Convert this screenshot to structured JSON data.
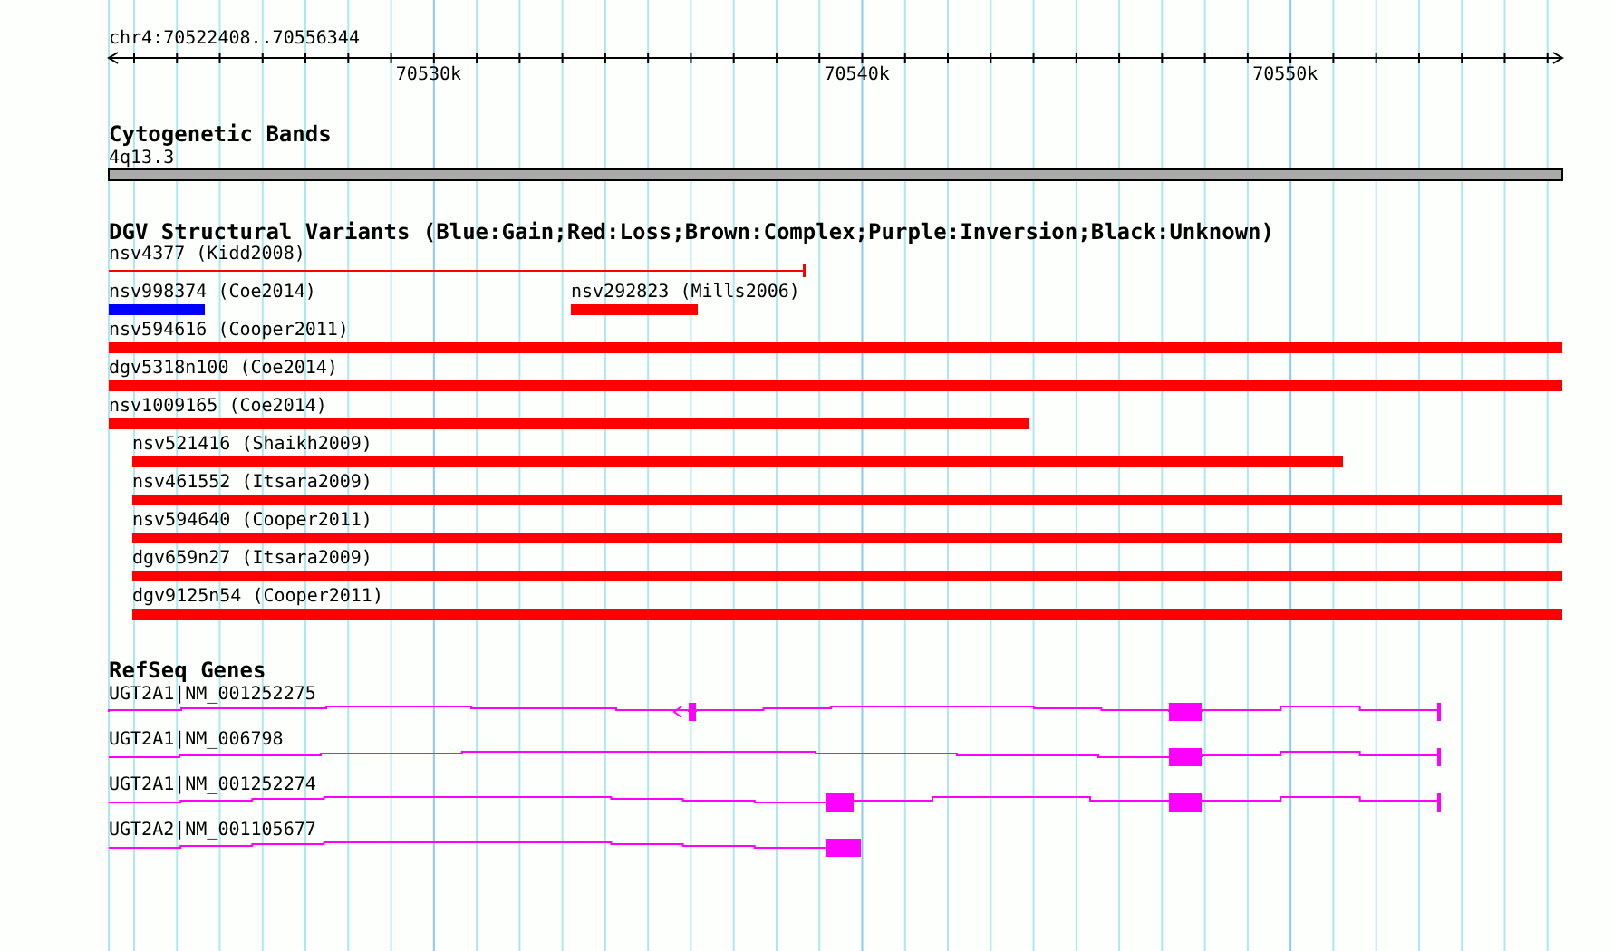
{
  "ruler": {
    "location": "chr4:70522408..70556344",
    "tick_labels": [
      "70530k",
      "70540k",
      "70550k"
    ]
  },
  "cytogenetic_bands": {
    "title": "Cytogenetic Bands",
    "band_label": "4q13.3"
  },
  "dgv": {
    "title": "DGV Structural Variants (Blue:Gain;Red:Loss;Brown:Complex;Purple:Inversion;Black:Unknown)",
    "features": [
      {
        "label": "nsv4377 (Kidd2008)",
        "kind": "line",
        "color": "#ff0000"
      },
      {
        "label": "nsv998374 (Coe2014)",
        "kind": "bar",
        "color": "#0000ff"
      },
      {
        "label": "nsv292823 (Mills2006)",
        "kind": "bar",
        "color": "#ff0000"
      },
      {
        "label": "nsv594616 (Cooper2011)",
        "kind": "bar",
        "color": "#ff0000"
      },
      {
        "label": "dgv5318n100 (Coe2014)",
        "kind": "bar",
        "color": "#ff0000"
      },
      {
        "label": "nsv1009165 (Coe2014)",
        "kind": "bar",
        "color": "#ff0000"
      },
      {
        "label": "nsv521416 (Shaikh2009)",
        "kind": "bar",
        "color": "#ff0000"
      },
      {
        "label": "nsv461552 (Itsara2009)",
        "kind": "bar",
        "color": "#ff0000"
      },
      {
        "label": "nsv594640 (Cooper2011)",
        "kind": "bar",
        "color": "#ff0000"
      },
      {
        "label": "dgv659n27 (Itsara2009)",
        "kind": "bar",
        "color": "#ff0000"
      },
      {
        "label": "dgv9125n54 (Cooper2011)",
        "kind": "bar",
        "color": "#ff0000"
      }
    ]
  },
  "refseq": {
    "title": "RefSeq Genes",
    "genes": [
      {
        "label": "UGT2A1|NM_001252275"
      },
      {
        "label": "UGT2A1|NM_006798"
      },
      {
        "label": "UGT2A1|NM_001252274"
      },
      {
        "label": "UGT2A2|NM_001105677"
      }
    ]
  }
}
